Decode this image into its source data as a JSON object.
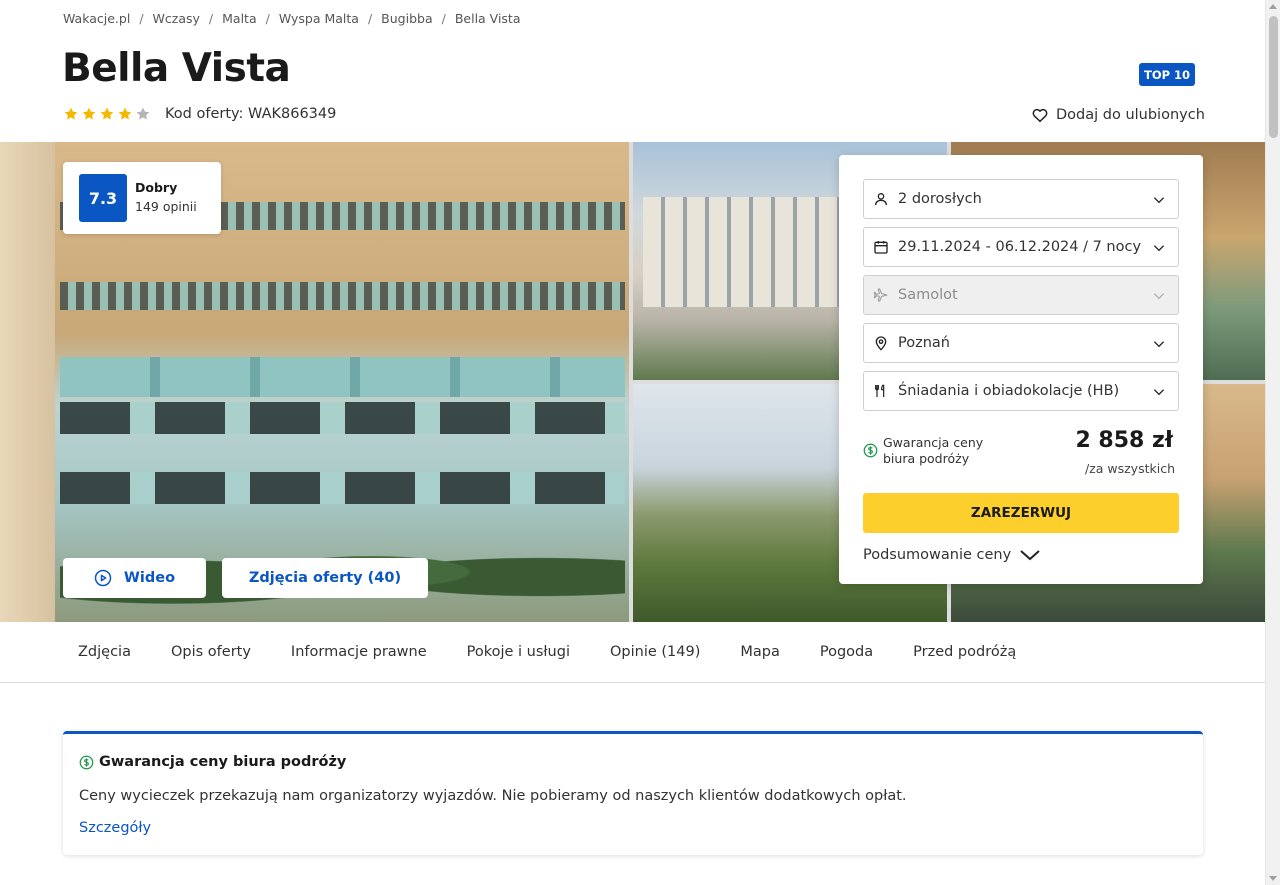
{
  "breadcrumb": [
    {
      "label": "Wakacje.pl"
    },
    {
      "label": "Wczasy"
    },
    {
      "label": "Malta"
    },
    {
      "label": "Wyspa Malta"
    },
    {
      "label": "Bugibba"
    },
    {
      "label": "Bella Vista"
    }
  ],
  "breadcrumb_separator": "/",
  "hotel": {
    "name": "Bella Vista",
    "badge": "TOP 10",
    "stars": 4,
    "stars_max": 5,
    "offer_code": "Kod oferty: WAK866349"
  },
  "favorite": {
    "label": "Dodaj do ulubionych"
  },
  "rating": {
    "score": "7.3",
    "label": "Dobry",
    "count": "149 opinii"
  },
  "gallery": {
    "video_label": "Wideo",
    "photos_label": "Zdjęcia oferty (40)"
  },
  "booking": {
    "guests": "2 dorosłych",
    "dates": "29.11.2024 - 06.12.2024 / 7 nocy",
    "transport": "Samolot",
    "departure": "Poznań",
    "board": "Śniadania i obiadokolacje (HB)",
    "guarantee_line1": "Gwarancja ceny",
    "guarantee_line2": "biura podróży",
    "price": "2 858 zł",
    "price_note": "/za wszystkich",
    "book_label": "ZAREZERWUJ",
    "summary_label": "Podsumowanie ceny"
  },
  "tabs": [
    {
      "label": "Zdjęcia"
    },
    {
      "label": "Opis oferty"
    },
    {
      "label": "Informacje prawne"
    },
    {
      "label": "Pokoje i usługi"
    },
    {
      "label": "Opinie (149)"
    },
    {
      "label": "Mapa"
    },
    {
      "label": "Pogoda"
    },
    {
      "label": "Przed podróżą"
    }
  ],
  "guarantee_box": {
    "title": "Gwarancja ceny biura podróży",
    "text": "Ceny wycieczek przekazują nam organizatorzy wyjazdów. Nie pobieramy od naszych klientów dodatkowych opłat.",
    "link": "Szczegóły"
  },
  "colors": {
    "accent": "#0a56c2",
    "book_button": "#fccf2d",
    "star_filled": "#f5b800",
    "star_empty": "#b5b5b5",
    "guarantee_icon": "#1a9a4a"
  },
  "icons": {
    "guests": "user-icon",
    "dates": "calendar-icon",
    "transport": "plane-icon",
    "departure": "location-pin-icon",
    "board": "cutlery-icon",
    "favorite": "heart-icon",
    "video": "play-circle-icon",
    "guarantee": "dollar-circle-icon",
    "chevron": "chevron-down-icon"
  }
}
